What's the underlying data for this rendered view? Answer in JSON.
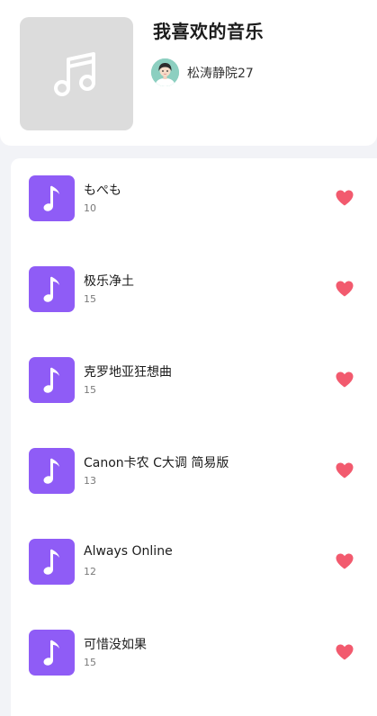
{
  "playlist": {
    "title": "我喜欢的音乐",
    "creator_name": "松涛静院27",
    "cover_icon": "music-note-icon"
  },
  "songs": [
    {
      "name": "もぺも",
      "count": "10"
    },
    {
      "name": "极乐净土",
      "count": "15"
    },
    {
      "name": "克罗地亚狂想曲",
      "count": "15"
    },
    {
      "name": "Canon卡农 C大调 简易版",
      "count": "13"
    },
    {
      "name": "Always Online",
      "count": "12"
    },
    {
      "name": "可惜没如果",
      "count": "15"
    }
  ],
  "colors": {
    "accent": "#8f5cf6",
    "heart": "#f25a6e",
    "cover_placeholder": "#dcdcdc",
    "page_background": "#f2f3f7"
  },
  "icons": {
    "song_art": "music-note-icon",
    "like": "heart-icon"
  }
}
